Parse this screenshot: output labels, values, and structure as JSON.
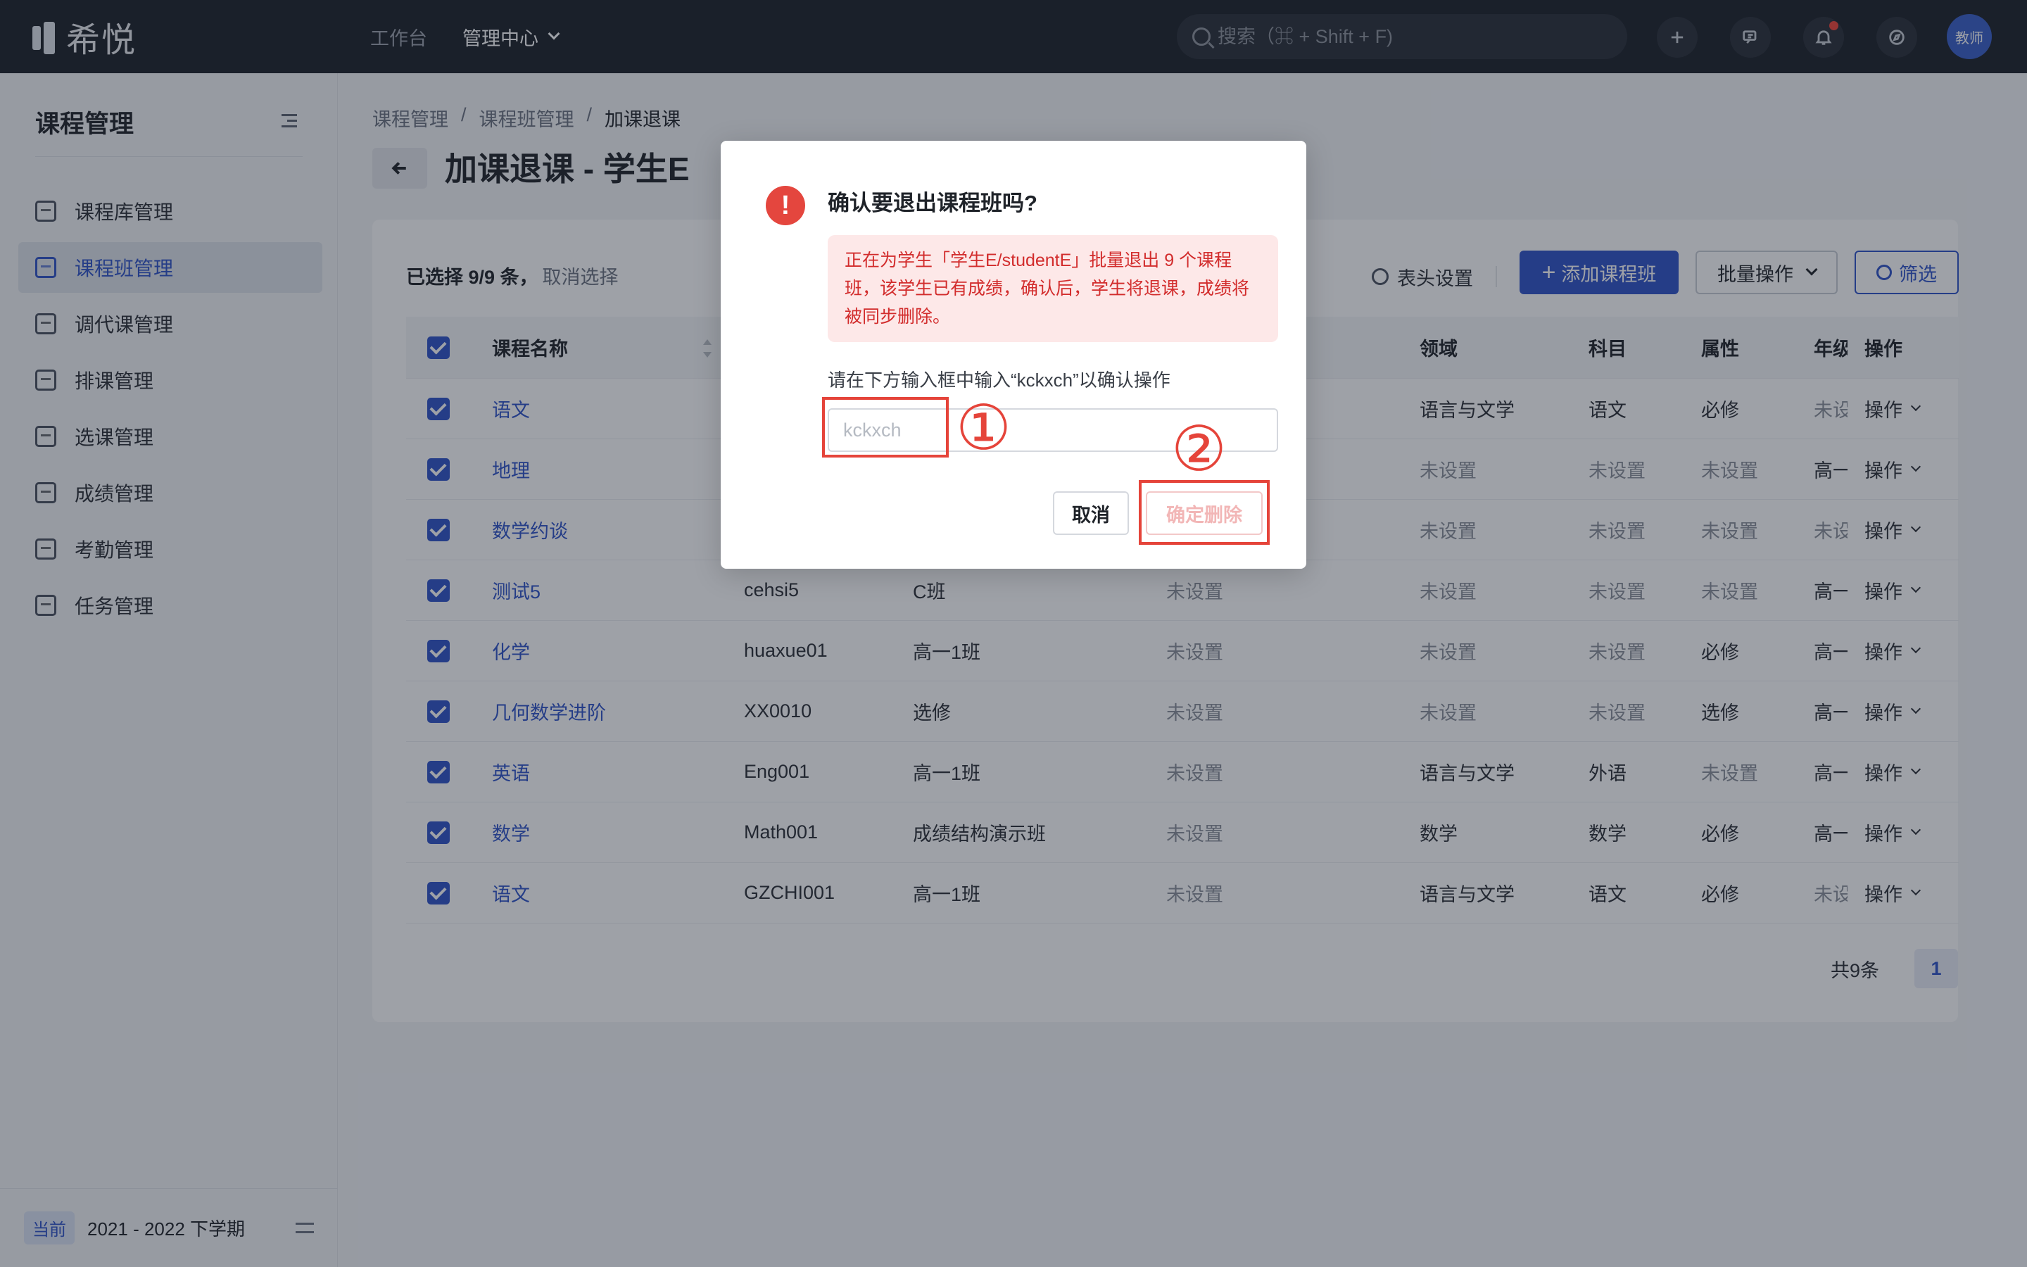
{
  "topbar": {
    "logo_text": "希悦",
    "nav": [
      {
        "label": "工作台"
      },
      {
        "label": "管理中心"
      }
    ],
    "search_placeholder": "搜索（⌘ + Shift + F)",
    "avatar_label": "教师",
    "icons": [
      "plus-icon",
      "chat-icon",
      "bell-icon",
      "compass-icon"
    ]
  },
  "sidebar": {
    "title": "课程管理",
    "items": [
      {
        "label": "课程库管理"
      },
      {
        "label": "课程班管理"
      },
      {
        "label": "调代课管理"
      },
      {
        "label": "排课管理"
      },
      {
        "label": "选课管理"
      },
      {
        "label": "成绩管理"
      },
      {
        "label": "考勤管理"
      },
      {
        "label": "任务管理"
      }
    ],
    "active_index": 1,
    "term_badge": "当前",
    "term_text": "2021 - 2022 下学期"
  },
  "breadcrumb": {
    "items": [
      "课程管理",
      "课程班管理",
      "加课退课"
    ],
    "separator": "/"
  },
  "page": {
    "title": "加课退课 - 学生E",
    "selection_text": "已选择 9/9 条，",
    "cancel_selection": "取消选择",
    "header_settings": "表头设置",
    "add_class": "添加课程班",
    "batch_ops": "批量操作",
    "filter": "筛选"
  },
  "table": {
    "headers": {
      "name": "课程名称",
      "field": "领域",
      "subject": "科目",
      "attr": "属性",
      "grade": "年级",
      "op": "操作"
    },
    "rows": [
      {
        "name": "语文",
        "code": "",
        "cls": "",
        "x": "",
        "field": "语言与文学",
        "subject": "语文",
        "attr": "必修",
        "grade": "未设",
        "op": "操作"
      },
      {
        "name": "地理",
        "code": "",
        "cls": "",
        "x": "",
        "field": "未设置",
        "subject": "未设置",
        "attr": "未设置",
        "grade": "高一",
        "op": "操作"
      },
      {
        "name": "数学约谈",
        "code": "",
        "cls": "",
        "x": "",
        "field": "未设置",
        "subject": "未设置",
        "attr": "未设置",
        "grade": "未设",
        "op": "操作"
      },
      {
        "name": "测试5",
        "code": "cehsi5",
        "cls": "C班",
        "x": "未设置",
        "field": "未设置",
        "subject": "未设置",
        "attr": "未设置",
        "grade": "高一",
        "op": "操作"
      },
      {
        "name": "化学",
        "code": "huaxue01",
        "cls": "高一1班",
        "x": "未设置",
        "field": "未设置",
        "subject": "未设置",
        "attr": "必修",
        "grade": "高一",
        "op": "操作"
      },
      {
        "name": "几何数学进阶",
        "code": "XX0010",
        "cls": "选修",
        "x": "未设置",
        "field": "未设置",
        "subject": "未设置",
        "attr": "选修",
        "grade": "高一",
        "op": "操作"
      },
      {
        "name": "英语",
        "code": "Eng001",
        "cls": "高一1班",
        "x": "未设置",
        "field": "语言与文学",
        "subject": "外语",
        "attr": "未设置",
        "grade": "高一",
        "op": "操作"
      },
      {
        "name": "数学",
        "code": "Math001",
        "cls": "成绩结构演示班",
        "x": "未设置",
        "field": "数学",
        "subject": "数学",
        "attr": "必修",
        "grade": "高一",
        "op": "操作"
      },
      {
        "name": "语文",
        "code": "GZCHI001",
        "cls": "高一1班",
        "x": "未设置",
        "field": "语言与文学",
        "subject": "语文",
        "attr": "必修",
        "grade": "未设",
        "op": "操作"
      }
    ]
  },
  "pagination": {
    "total": "共9条",
    "current": "1"
  },
  "modal": {
    "title": "确认要退出课程班吗?",
    "alert": "正在为学生「学生E/studentE」批量退出 9 个课程班，该学生已有成绩，确认后，学生将退课，成绩将被同步删除。",
    "hint": "请在下方输入框中输入“kckxch”以确认操作",
    "input_placeholder": "kckxch",
    "input_value": "",
    "cancel_label": "取消",
    "confirm_label": "确定删除"
  },
  "annotations": {
    "step1": "①",
    "step2": "②"
  },
  "colors": {
    "primary": "#2f54c8",
    "danger": "#e4463e",
    "topbar": "#1d2129"
  }
}
